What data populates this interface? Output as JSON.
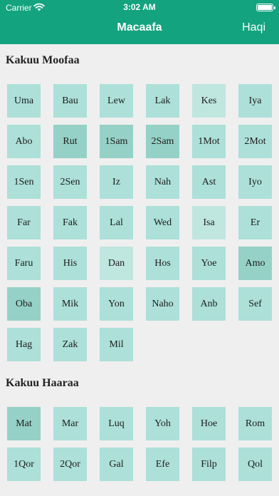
{
  "status_bar": {
    "carrier": "Carrier",
    "time": "3:02 AM"
  },
  "nav": {
    "title": "Macaafa",
    "right_label": "Haqi"
  },
  "colors": {
    "accent": "#13a37f",
    "tile": "#ace0d8",
    "tile_dark": "#95d1c6",
    "background": "#efefef"
  },
  "sections": [
    {
      "title": "Kakuu Moofaa",
      "books": [
        "Uma",
        "Bau",
        "Lew",
        "Lak",
        "Kes",
        "Iya",
        "Abo",
        "Rut",
        "1Sam",
        "2Sam",
        "1Mot",
        "2Mot",
        "1Sen",
        "2Sen",
        "Iz",
        "Nah",
        "Ast",
        "Iyo",
        "Far",
        "Fak",
        "Lal",
        "Wed",
        "Isa",
        "Er",
        "Faru",
        "His",
        "Dan",
        "Hos",
        "Yoe",
        "Amo",
        "Oba",
        "Mik",
        "Yon",
        "Naho",
        "Anb",
        "Sef",
        "Hag",
        "Zak",
        "Mil"
      ]
    },
    {
      "title": "Kakuu Haaraa",
      "books": [
        "Mat",
        "Mar",
        "Luq",
        "Yoh",
        "Hoe",
        "Rom",
        "1Qor",
        "2Qor",
        "Gal",
        "Efe",
        "Filp",
        "Qol"
      ]
    }
  ]
}
